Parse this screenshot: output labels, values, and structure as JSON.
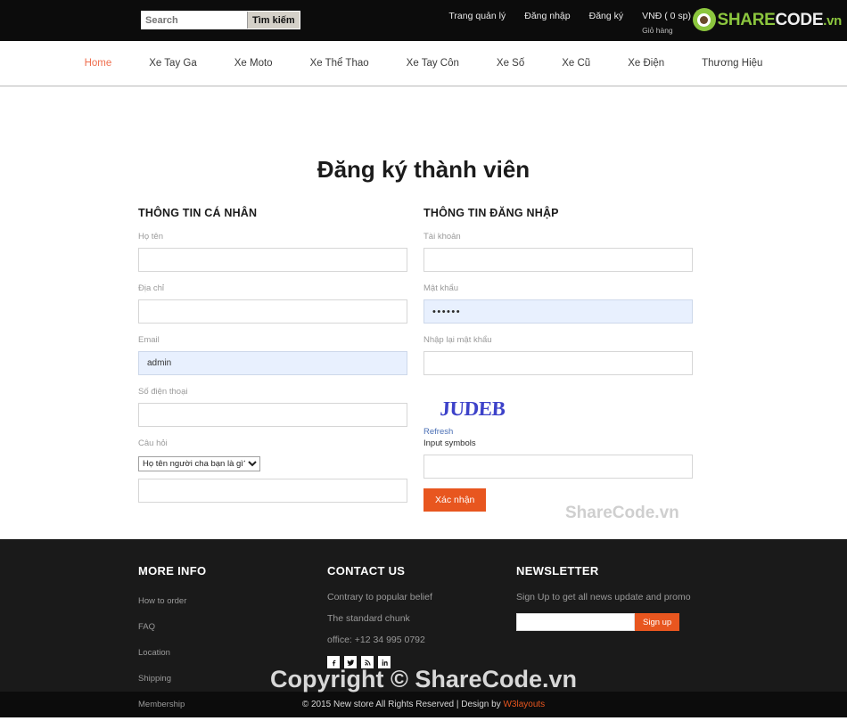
{
  "header": {
    "search": {
      "placeholder": "Search",
      "value": "",
      "button_label": "Tìm kiếm"
    },
    "links": [
      {
        "label": "Trang quản lý"
      },
      {
        "label": "Đăng nhập"
      },
      {
        "label": "Đăng ký"
      }
    ],
    "cart": {
      "amount": "VNĐ ( 0 sp)",
      "sub_label": "Giỏ hàng",
      "icon": "cart-icon"
    },
    "logo": {
      "part1": "SHARE",
      "part2": "CODE",
      "part3": ".vn"
    }
  },
  "nav": {
    "items": [
      {
        "label": "Home",
        "active": true
      },
      {
        "label": "Xe Tay Ga",
        "active": false
      },
      {
        "label": "Xe Moto",
        "active": false
      },
      {
        "label": "Xe Thể Thao",
        "active": false
      },
      {
        "label": "Xe Tay Côn",
        "active": false
      },
      {
        "label": "Xe Số",
        "active": false
      },
      {
        "label": "Xe Cũ",
        "active": false
      },
      {
        "label": "Xe Điện",
        "active": false
      },
      {
        "label": "Thương Hiệu",
        "active": false
      }
    ]
  },
  "main": {
    "title": "Đăng ký thành viên",
    "personal": {
      "section_title": "THÔNG TIN CÁ NHÂN",
      "fields": {
        "fullname_label": "Họ tên",
        "fullname_value": "",
        "address_label": "Địa chỉ",
        "address_value": "",
        "email_label": "Email",
        "email_value": "admin",
        "phone_label": "Số điện thoại",
        "phone_value": "",
        "question_label": "Câu hỏi",
        "question_selected": "Họ tên người cha bạn là gì?",
        "answer_value": ""
      }
    },
    "account": {
      "section_title": "THÔNG TIN ĐĂNG NHẬP",
      "fields": {
        "username_label": "Tài khoản",
        "username_value": "",
        "password_label": "Mật khẩu",
        "password_value": "••••••",
        "repassword_label": "Nhập lại mật khẩu",
        "repassword_value": "",
        "captcha_text": "JUDEB",
        "refresh_label": "Refresh",
        "captcha_input_label": "Input symbols",
        "captcha_input_value": "",
        "submit_label": "Xác nhận"
      }
    }
  },
  "watermarks": {
    "middle": "ShareCode.vn",
    "bottom": "Copyright © ShareCode.vn"
  },
  "footer": {
    "more_info": {
      "title": "MORE INFO",
      "items": [
        {
          "label": "How to order"
        },
        {
          "label": "FAQ"
        },
        {
          "label": "Location"
        },
        {
          "label": "Shipping"
        },
        {
          "label": "Membership"
        }
      ]
    },
    "contact": {
      "title": "CONTACT US",
      "line1": "Contrary to popular belief",
      "line2": "The standard chunk",
      "line3": "office: +12 34 995 0792",
      "socials": [
        {
          "name": "facebook-icon"
        },
        {
          "name": "twitter-icon"
        },
        {
          "name": "rss-icon"
        },
        {
          "name": "linkedin-icon"
        }
      ]
    },
    "newsletter": {
      "title": "NEWSLETTER",
      "description": "Sign Up to get all news update and promo",
      "input_value": "",
      "button_label": "Sign up"
    },
    "copyright_prefix": "© 2015 New store All Rights Reserved | Design by ",
    "copyright_link": "W3layouts"
  },
  "colors": {
    "accent_orange": "#e8561f",
    "nav_active": "#ef6e4e",
    "logo_green": "#8cc63e",
    "captcha_blue": "#3d42c9",
    "autofill_blue": "#e8f0fe"
  }
}
